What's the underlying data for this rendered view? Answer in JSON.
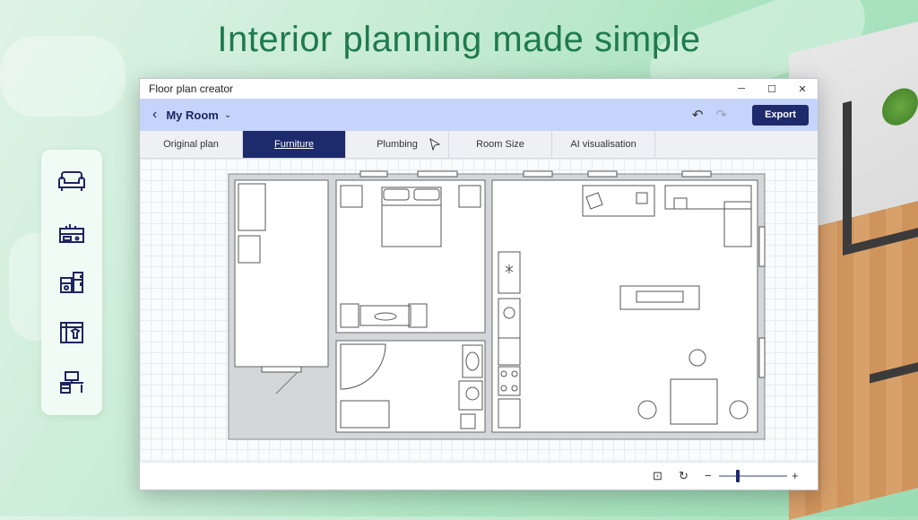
{
  "headline": "Interior planning made simple",
  "window": {
    "title": "Floor plan creator",
    "controls": [
      "─",
      "☐",
      "✕"
    ]
  },
  "toolbar": {
    "back_icon": "‹",
    "room_name": "My Room",
    "dropdown_icon": "⌄",
    "undo_icon": "↶",
    "redo_icon": "↷",
    "export_label": "Export"
  },
  "tabs": [
    {
      "label": "Original plan",
      "active": false
    },
    {
      "label": "Furniture",
      "active": true
    },
    {
      "label": "Plumbing",
      "active": false
    },
    {
      "label": "Room Size",
      "active": false
    },
    {
      "label": "AI visualisation",
      "active": false
    }
  ],
  "sidebar": {
    "items": [
      "sofa-icon",
      "kitchen-stove-icon",
      "appliances-icon",
      "wardrobe-icon",
      "desk-icon"
    ]
  },
  "statusbar": {
    "fit_icon": "⊡",
    "rotate_icon": "↻",
    "zoom_out": "−",
    "zoom_in": "+",
    "zoom_fraction": 0.25
  },
  "colors": {
    "accent": "#1d2a6b",
    "toolbar": "#c6d4fb",
    "headline": "#1f7a4c",
    "icons": "#1d2560"
  }
}
